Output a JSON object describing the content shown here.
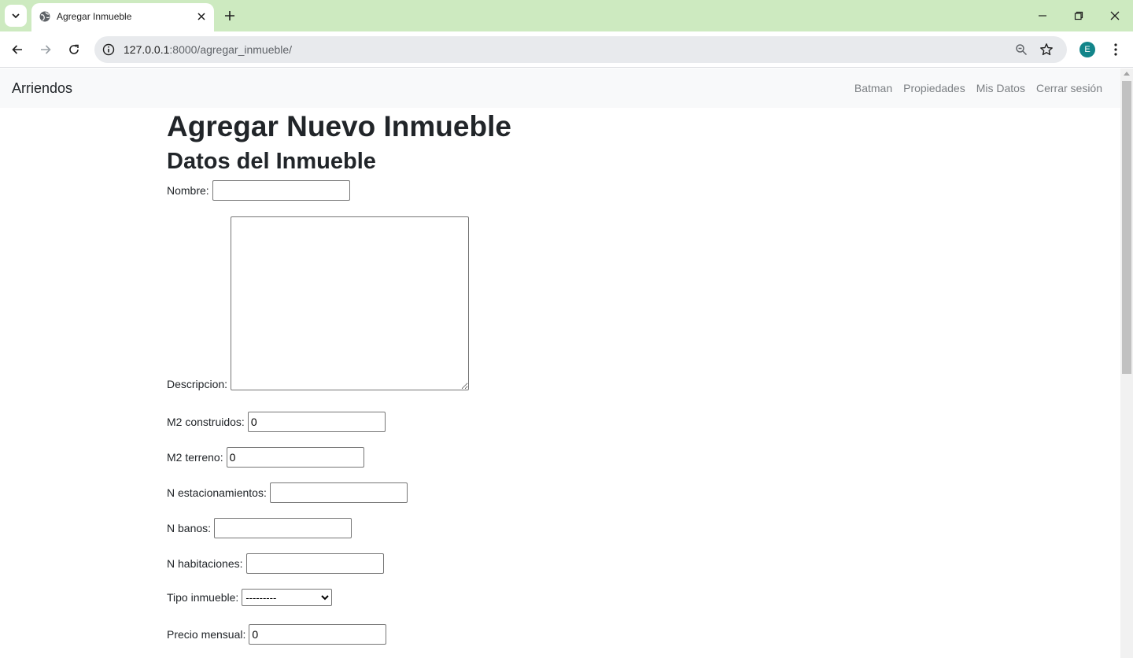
{
  "browser": {
    "tab_title": "Agregar Inmueble",
    "url_host": "127.0.0.1",
    "url_rest": ":8000/agregar_inmueble/",
    "profile_initial": "E"
  },
  "navbar": {
    "brand": "Arriendos",
    "links": [
      "Batman",
      "Propiedades",
      "Mis Datos",
      "Cerrar sesión"
    ]
  },
  "page": {
    "title": "Agregar Nuevo Inmueble",
    "section_title": "Datos del Inmueble"
  },
  "form": {
    "nombre": {
      "label": "Nombre:",
      "value": ""
    },
    "descripcion": {
      "label": "Descripcion:",
      "value": ""
    },
    "m2_construidos": {
      "label": "M2 construidos:",
      "value": "0"
    },
    "m2_terreno": {
      "label": "M2 terreno:",
      "value": "0"
    },
    "n_estacionamientos": {
      "label": "N estacionamientos:",
      "value": ""
    },
    "n_banos": {
      "label": "N banos:",
      "value": ""
    },
    "n_habitaciones": {
      "label": "N habitaciones:",
      "value": ""
    },
    "tipo_inmueble": {
      "label": "Tipo inmueble:",
      "selected": "---------"
    },
    "precio_mensual": {
      "label": "Precio mensual:",
      "value": "0"
    }
  }
}
